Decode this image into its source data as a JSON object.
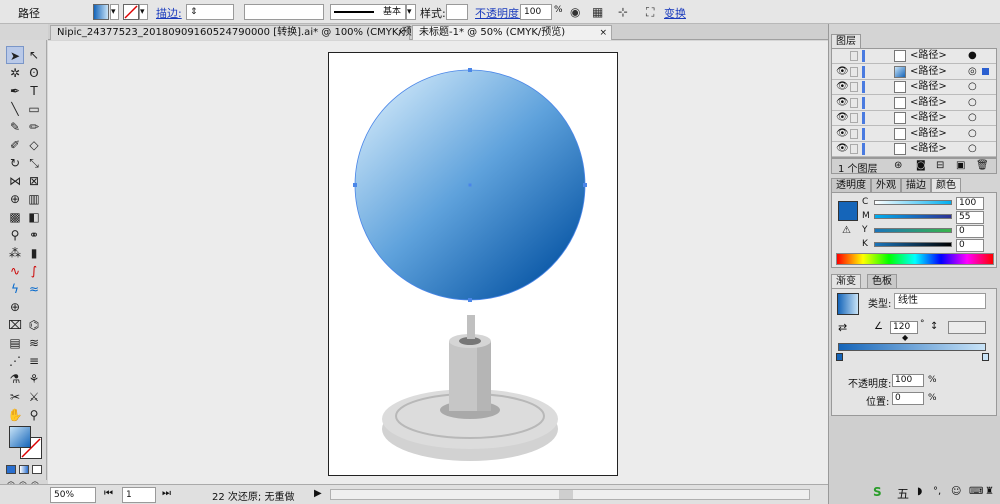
{
  "control_bar": {
    "object_label": "路径",
    "stroke_label": "描边:",
    "stroke_style": "基本",
    "style_label": "样式:",
    "opacity_label": "不透明度:",
    "opacity_value": "100",
    "opacity_unit": "%",
    "transform_label": "变换"
  },
  "tabs": [
    {
      "label": "Nipic_24377523_20180909160524790000  [转换].ai* @ 100% (CMYK/预览)",
      "close": "×"
    },
    {
      "label": "未标题-1* @ 50% (CMYK/预览)",
      "close": "×"
    }
  ],
  "layers_panel": {
    "title": "图层",
    "rows": [
      "<路径>",
      "<路径>",
      "<路径>",
      "<路径>",
      "<路径>",
      "<路径>",
      "<路径>"
    ],
    "footer_count": "1 个图层"
  },
  "color_panel": {
    "tabs": [
      "透明度",
      "外观",
      "描边",
      "颜色"
    ],
    "channels": [
      {
        "label": "C",
        "value": "100"
      },
      {
        "label": "M",
        "value": "55"
      },
      {
        "label": "Y",
        "value": "0"
      },
      {
        "label": "K",
        "value": "0"
      }
    ],
    "fill_color": "#1565b9"
  },
  "gradient_panel": {
    "tabs": [
      "渐变",
      "色板"
    ],
    "type_label": "类型:",
    "type_value": "线性",
    "angle_value": "120",
    "angle_unit": "°",
    "opacity_label": "不透明度:",
    "opacity_value": "100",
    "opacity_unit": "%",
    "location_label": "位置:",
    "location_value": "0",
    "location_unit": "%"
  },
  "status_bar": {
    "zoom": "50%",
    "page": "1",
    "message": "22 次还原; 无重做"
  },
  "taskbar": {
    "ime_label": "五"
  },
  "colors": {
    "globe_light": "#c8e3f7",
    "globe_mid": "#5fa2dc",
    "globe_dark": "#0d5aa8",
    "stand_gray": "#c8c8c8",
    "accent": "#1565b9"
  }
}
